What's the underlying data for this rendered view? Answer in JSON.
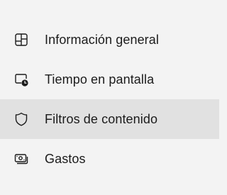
{
  "nav": {
    "items": [
      {
        "label": "Información general",
        "icon": "dashboard-grid-icon",
        "selected": false
      },
      {
        "label": "Tiempo en pantalla",
        "icon": "screen-time-icon",
        "selected": false
      },
      {
        "label": "Filtros de contenido",
        "icon": "shield-icon",
        "selected": true
      },
      {
        "label": "Gastos",
        "icon": "money-icon",
        "selected": false
      }
    ]
  },
  "colors": {
    "background": "#f3f3f3",
    "selected_background": "#e1e1e1",
    "text": "#1b1b1b",
    "icon": "#1b1b1b"
  }
}
